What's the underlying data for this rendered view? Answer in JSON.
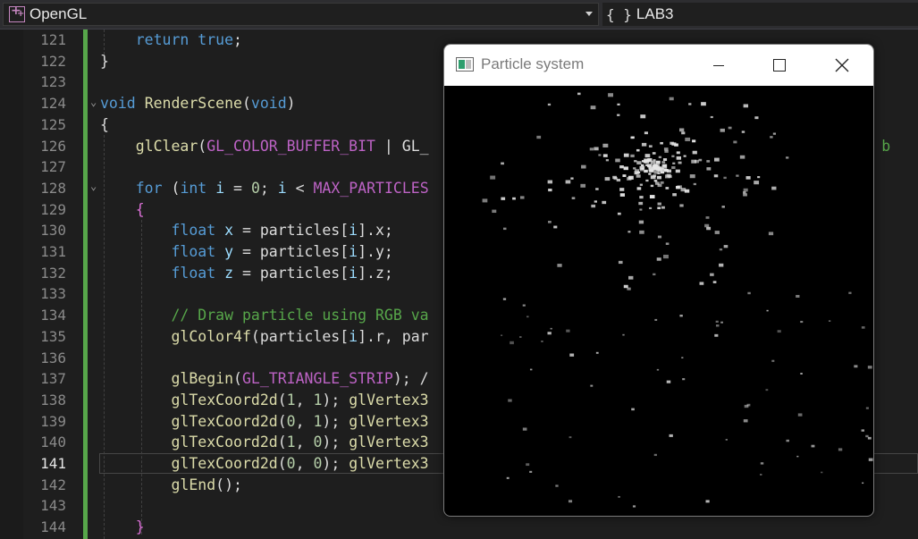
{
  "nav": {
    "project": "OpenGL",
    "scope": "LAB3",
    "scope_icon": "{ }"
  },
  "editor": {
    "line_numbers": [
      "121",
      "122",
      "123",
      "124",
      "125",
      "126",
      "127",
      "128",
      "129",
      "130",
      "131",
      "132",
      "133",
      "134",
      "135",
      "136",
      "137",
      "138",
      "139",
      "140",
      "141",
      "142",
      "143",
      "144"
    ],
    "current_line": "141"
  },
  "particle_window": {
    "title": "Particle system"
  },
  "colors": {
    "keyword": "#569cd6",
    "function": "#dcdcaa",
    "macro": "#bd63c5",
    "comment": "#57a64a",
    "number": "#b5cea8",
    "variable": "#9cdcfe",
    "change_bar": "#57a64a"
  }
}
